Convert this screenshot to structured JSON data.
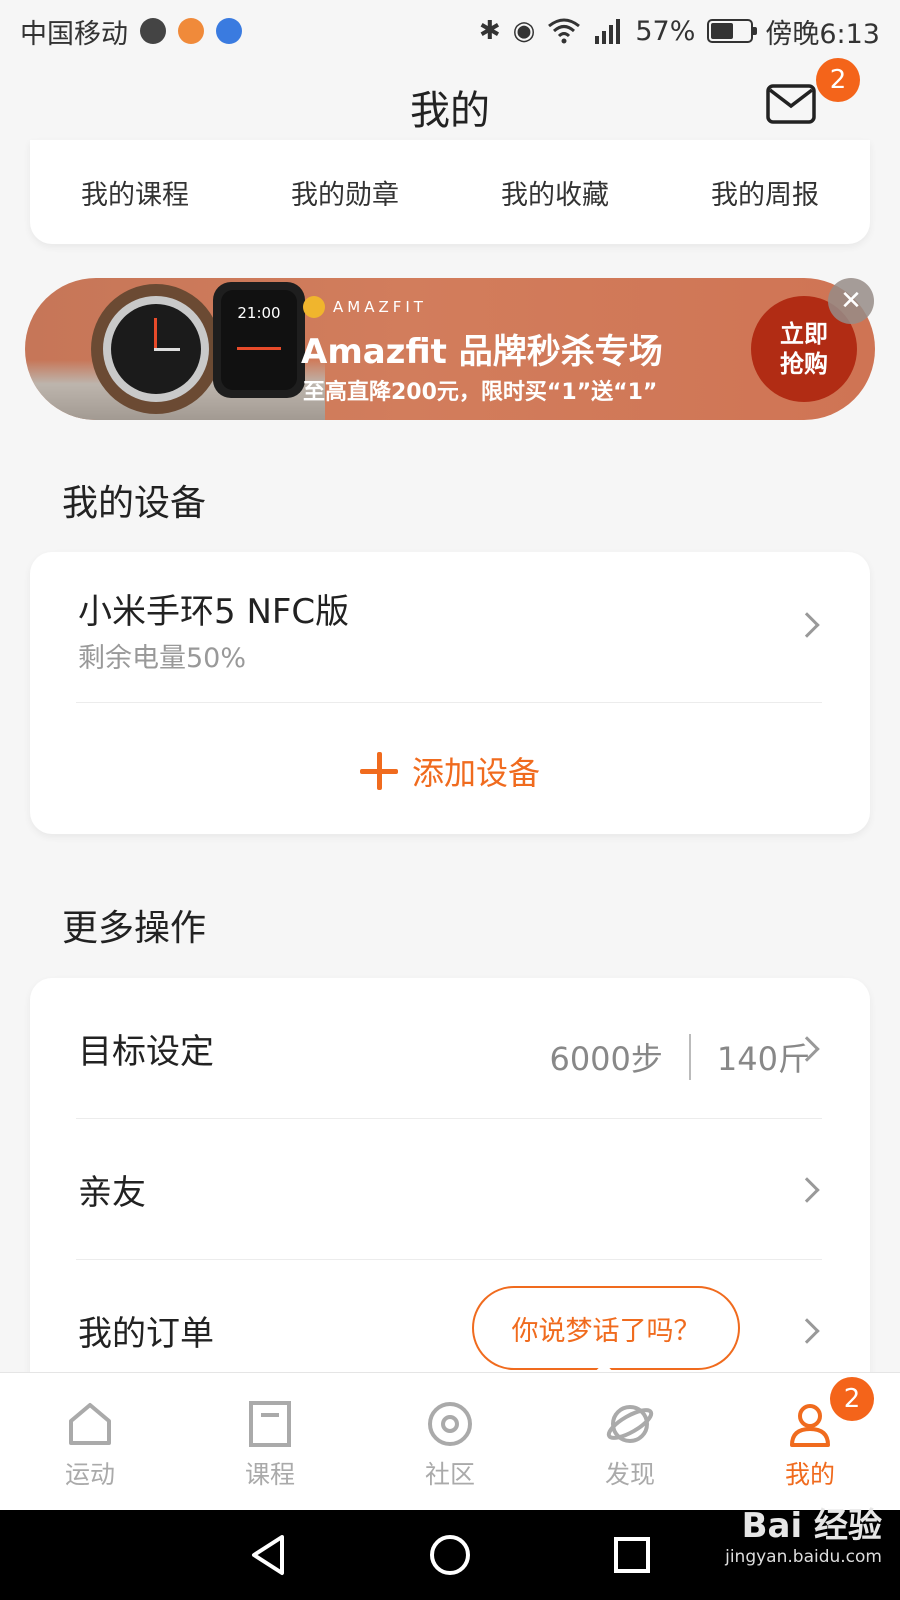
{
  "status_bar": {
    "carrier": "中国移动",
    "battery": "57%",
    "battery_level": 0.57,
    "time": "傍晚6:13"
  },
  "header": {
    "title": "我的",
    "mail_badge": "2"
  },
  "quick_links": [
    "我的课程",
    "我的勋章",
    "我的收藏",
    "我的周报"
  ],
  "banner": {
    "brand": "AMAZFIT",
    "title": "Amazfit 品牌秒杀专场",
    "subtitle": "至高直降200元，限时买“1”送“1”",
    "button_line1": "立即",
    "button_line2": "抢购",
    "watch_face_time": "21:00"
  },
  "devices_section": {
    "title": "我的设备",
    "device_name": "小米手环5 NFC版",
    "device_battery": "剩余电量50%",
    "add_device": "添加设备"
  },
  "more_section": {
    "title": "更多操作",
    "rows": [
      {
        "label": "目标设定",
        "steps": "6000步",
        "weight": "140斤"
      },
      {
        "label": "亲友"
      },
      {
        "label": "我的订单"
      }
    ],
    "bubble": "你说梦话了吗？"
  },
  "tabs": [
    {
      "label": "运动",
      "icon": "home-icon"
    },
    {
      "label": "课程",
      "icon": "course-icon"
    },
    {
      "label": "社区",
      "icon": "community-icon"
    },
    {
      "label": "发现",
      "icon": "discover-icon"
    },
    {
      "label": "我的",
      "icon": "profile-icon",
      "active": true,
      "badge": "2"
    }
  ],
  "watermark": {
    "logo": "Bai 经验",
    "url": "jingyan.baidu.com"
  },
  "colors": {
    "accent": "#f06b1e",
    "badge": "#f4641a",
    "banner_button": "#b12c14"
  }
}
